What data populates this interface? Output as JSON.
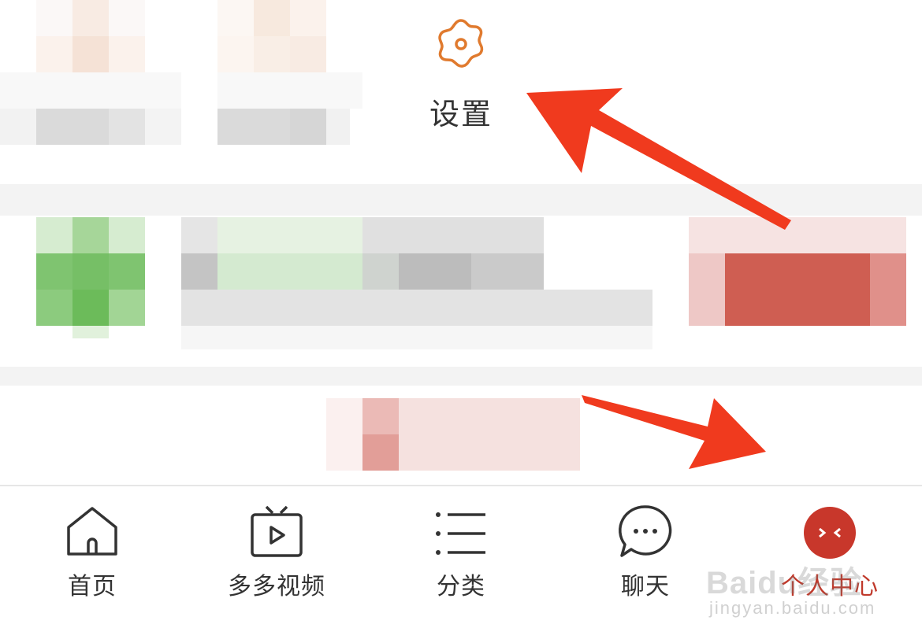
{
  "settings": {
    "label": "设置",
    "icon": "gear-icon",
    "accent_color": "#e07a2e"
  },
  "tabbar": {
    "tabs": [
      {
        "label": "首页",
        "icon": "home-icon",
        "active": false
      },
      {
        "label": "多多视频",
        "icon": "tv-play-icon",
        "active": false
      },
      {
        "label": "分类",
        "icon": "list-icon",
        "active": false
      },
      {
        "label": "聊天",
        "icon": "chat-bubble-icon",
        "active": false
      },
      {
        "label": "个人中心",
        "icon": "avatar-icon",
        "active": true
      }
    ],
    "active_color": "#c0392b"
  },
  "annotations": {
    "arrow_color": "#f03a1e"
  },
  "watermark": {
    "logo": "Baidu经验",
    "url": "jingyan.baidu.com"
  }
}
